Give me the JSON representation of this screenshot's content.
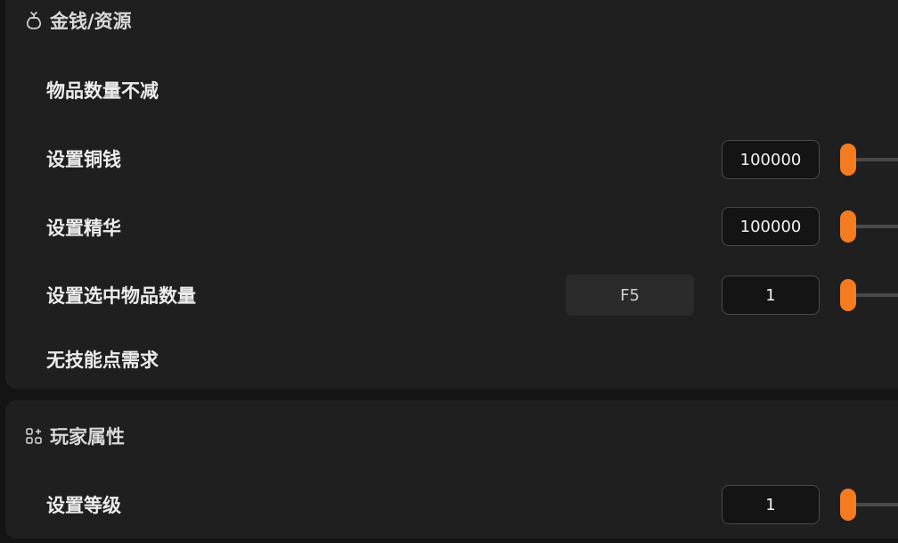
{
  "sections": {
    "money": {
      "title": "金钱/资源",
      "icon": "money-bag-icon",
      "rows": {
        "items_no_decrease": {
          "label": "物品数量不减"
        },
        "set_copper": {
          "label": "设置铜钱",
          "value": "100000",
          "slider_level": 0
        },
        "set_essence": {
          "label": "设置精华",
          "value": "100000",
          "slider_level": 0
        },
        "set_selected_qty": {
          "label": "设置选中物品数量",
          "hotkey": "F5",
          "value": "1",
          "slider_level": 0
        },
        "no_skill_point": {
          "label": "无技能点需求"
        }
      }
    },
    "player": {
      "title": "玩家属性",
      "icon": "grid-plus-icon",
      "rows": {
        "set_level": {
          "label": "设置等级",
          "value": "1",
          "slider_level": 0
        }
      }
    }
  },
  "colors": {
    "accent": "#f47b20",
    "panel": "#1f1f1f",
    "background": "#141414"
  }
}
